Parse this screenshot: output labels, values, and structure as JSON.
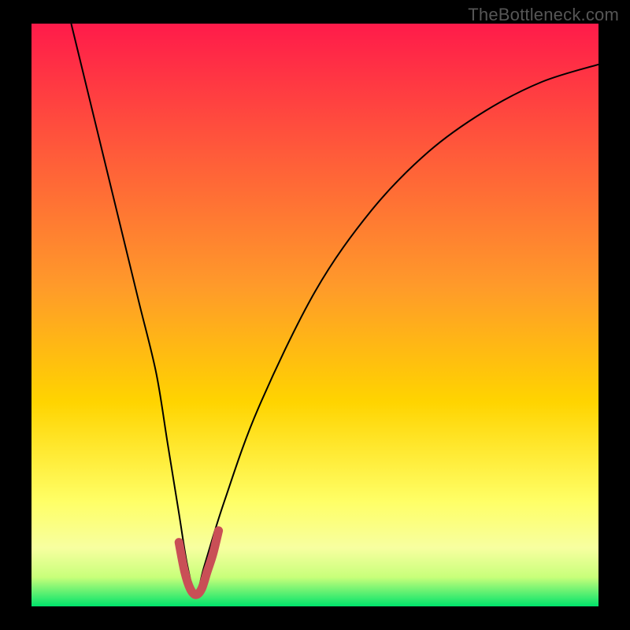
{
  "watermark": "TheBottleneck.com",
  "chart_data": {
    "type": "line",
    "title": "",
    "xlabel": "",
    "ylabel": "",
    "xlim": [
      0,
      100
    ],
    "ylim": [
      0,
      100
    ],
    "grid": false,
    "gradient_colors": {
      "top": "#ff1b4a",
      "mid_upper": "#ff7a33",
      "mid": "#ffd400",
      "mid_lower": "#ffff66",
      "lower_band": "#f7ffa0",
      "bottom": "#00e36b"
    },
    "series": [
      {
        "name": "bottleneck-curve",
        "color": "#000000",
        "x": [
          7,
          10,
          13,
          16,
          19,
          22,
          24,
          26,
          27.5,
          29,
          30.5,
          34,
          40,
          50,
          60,
          70,
          80,
          90,
          100
        ],
        "y": [
          100,
          88,
          76,
          64,
          52,
          40,
          28,
          16,
          7,
          2,
          7,
          18,
          34,
          54,
          68,
          78,
          85,
          90,
          93
        ]
      },
      {
        "name": "valley-highlight",
        "color": "#c94f56",
        "x": [
          26,
          27,
          28,
          29,
          30,
          31,
          32,
          33
        ],
        "y": [
          11,
          6,
          3,
          2,
          3,
          6,
          9,
          13
        ]
      }
    ],
    "annotations": []
  }
}
